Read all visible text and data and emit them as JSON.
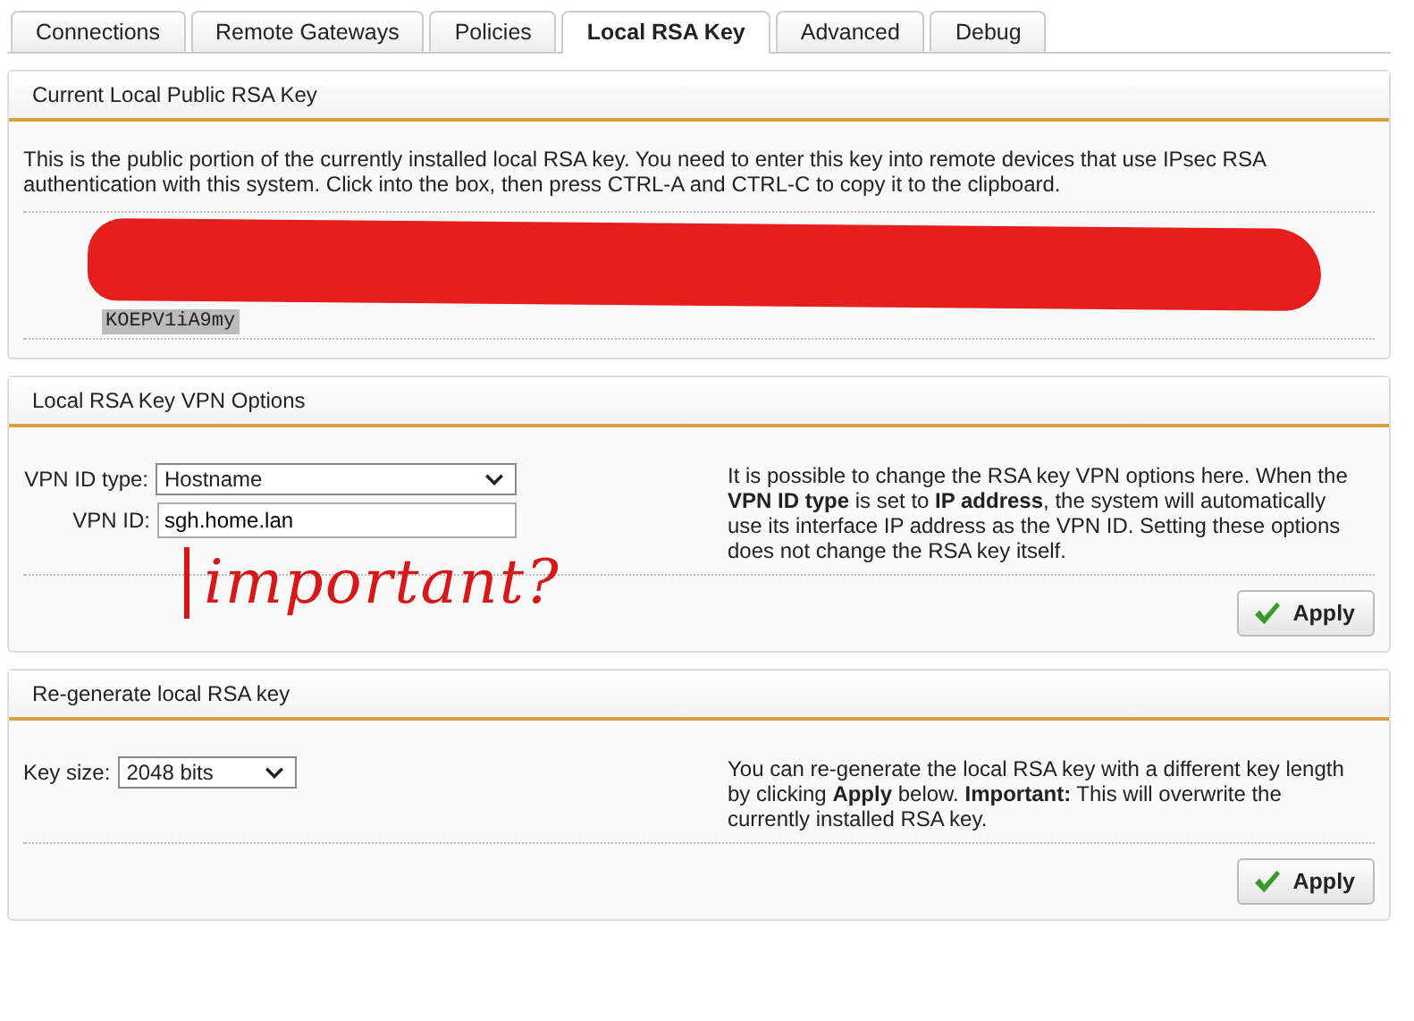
{
  "tabs": [
    {
      "label": "Connections",
      "selected": false
    },
    {
      "label": "Remote Gateways",
      "selected": false
    },
    {
      "label": "Policies",
      "selected": false
    },
    {
      "label": "Local RSA Key",
      "selected": true
    },
    {
      "label": "Advanced",
      "selected": false
    },
    {
      "label": "Debug",
      "selected": false
    }
  ],
  "public_key": {
    "title": "Current Local Public RSA Key",
    "description": "This is the public portion of the currently installed local RSA key. You need to enter this key into remote devices that use IPsec RSA authentication with this system. Click into the box, then press CTRL-A and CTRL-C to copy it to the clipboard.",
    "key_text": "KOEPV1iA9my",
    "redacted": true
  },
  "vpn_options": {
    "title": "Local RSA Key VPN Options",
    "fields": [
      {
        "kind": "select",
        "label": "VPN ID type:",
        "value": "Hostname"
      },
      {
        "kind": "text",
        "label": "VPN ID:",
        "value": "sgh.home.lan"
      }
    ],
    "help": "It is possible to change the RSA key VPN options here. When the **VPN ID type** is set to **IP address**, the system will automatically use its interface IP address as the VPN ID. Setting these options does not change the RSA key itself.",
    "button": "Apply"
  },
  "annotation": {
    "text": "important?"
  },
  "regenerate": {
    "title": "Re-generate local RSA key",
    "fields": [
      {
        "kind": "select",
        "label": "Key size:",
        "value": "2048 bits"
      }
    ],
    "help": "You can re-generate the local RSA key with a different key length by clicking **Apply** below. **Important:** This will overwrite the currently installed RSA key.",
    "button": "Apply"
  }
}
